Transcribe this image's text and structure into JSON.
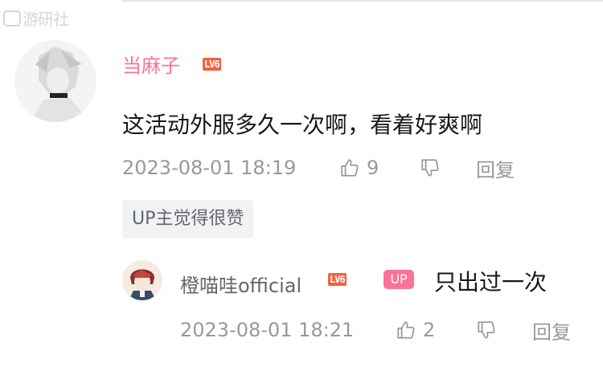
{
  "watermark": {
    "text": "游研社"
  },
  "main_comment": {
    "username": "当麻子",
    "level": "LV6",
    "content": "这活动外服多久一次啊，看着好爽啊",
    "time": "2023-08-01 18:19",
    "likes": "9",
    "reply_label": "回复",
    "up_liked_tag": "UP主觉得很赞"
  },
  "reply_comment": {
    "username": "橙喵哇official",
    "level": "LV6",
    "up_badge": "UP",
    "content": "只出过一次",
    "time": "2023-08-01 18:21",
    "likes": "2",
    "reply_label": "回复"
  },
  "colors": {
    "username_pink": "#fb7299",
    "level_orange": "#f6603f",
    "meta_gray": "#9499a0",
    "text_dark": "#18191c"
  }
}
